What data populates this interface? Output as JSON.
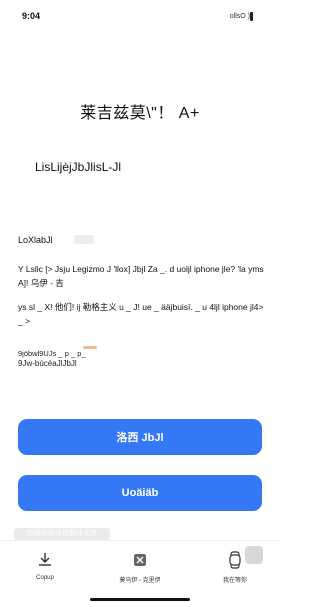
{
  "status_bar": {
    "time": "9:04",
    "indicators": "ollsO )"
  },
  "header": {
    "title": "莱吉兹莫\\\"！ A+",
    "subtitle": "LisLijèjJbJlisL-Jl"
  },
  "section": {
    "label": "LoXlabJl"
  },
  "paragraphs": [
    "Y Lslic [> Jsju Legizmo J 'llox] Jbjl Za _. d uolјl iphone jle? 'la yms A]! 乌伊 - 吉",
    "ys sl _ X! 他们! ij 勒格主义 u _ J! ue _ ääjbuisī. _ u 4ljl iphone jl4> _ >"
  ],
  "small_lines": [
    "9jöbwl9UJs _ p _ p_",
    "9Jw-búcéaJlJbJl"
  ],
  "buttons": {
    "primary": "洛西 JbJl",
    "secondary": "Uoäiäb"
  },
  "watermark": "由腾讯网页快翻译支持",
  "tabbar": {
    "items": [
      {
        "label": "Copup",
        "icon": "download-icon"
      },
      {
        "label": "莫乌伊 - 克里伊",
        "icon": "trash-icon"
      },
      {
        "label": "我在等你",
        "icon": "watch-icon"
      }
    ]
  },
  "colors": {
    "accent": "#3478f6"
  }
}
